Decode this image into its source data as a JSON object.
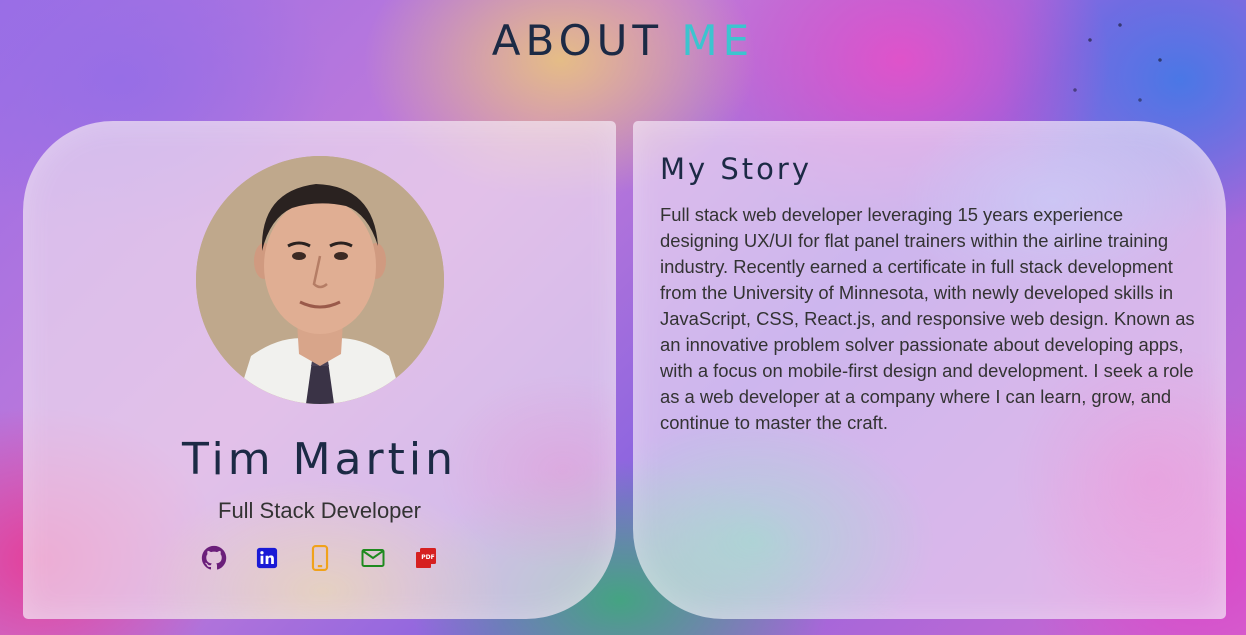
{
  "header": {
    "title_main": "ABOUT",
    "title_accent": "ME"
  },
  "profile": {
    "name": "Tim Martin",
    "role": "Full Stack Developer",
    "socials": [
      {
        "icon": "github-icon",
        "color": "#6b1f7a"
      },
      {
        "icon": "linkedin-icon",
        "color": "#1a1ad6"
      },
      {
        "icon": "phone-icon",
        "color": "#f0a21a"
      },
      {
        "icon": "email-icon",
        "color": "#1f8a1f"
      },
      {
        "icon": "pdf-icon",
        "color": "#d62020"
      }
    ]
  },
  "story": {
    "title": "My Story",
    "text": "Full stack web developer leveraging 15 years experience designing UX/UI for flat panel trainers within the airline training industry. Recently earned a certificate in full stack development from the University of Minnesota, with newly developed skills in JavaScript, CSS, React.js, and responsive web design. Known as an innovative problem solver passionate about developing apps, with a focus on mobile-first design and development. I seek a role as a web developer at a company where I can learn, grow, and continue to master the craft."
  },
  "colors": {
    "title_dark": "#1c2a45",
    "title_accent": "#3cc4cf"
  }
}
